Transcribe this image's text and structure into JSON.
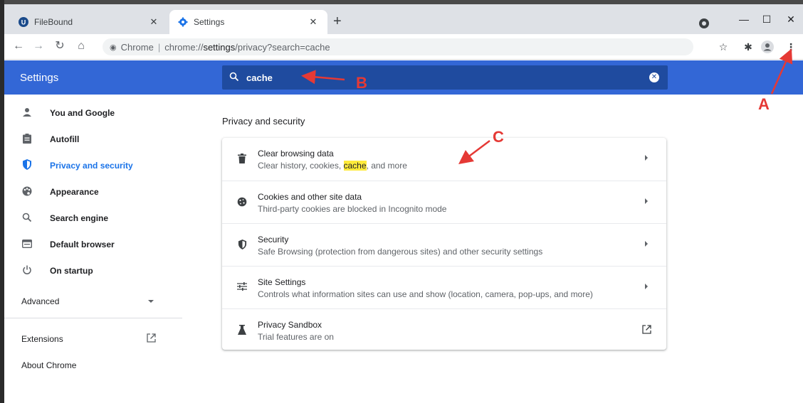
{
  "tabs": [
    {
      "title": "FileBound",
      "icon": "filebound-icon",
      "active": false
    },
    {
      "title": "Settings",
      "icon": "gear-icon",
      "active": true
    }
  ],
  "toolbar": {
    "scheme_label": "Chrome",
    "url_host": "chrome://",
    "url_path_bold": "settings",
    "url_rest": "/privacy?search=cache"
  },
  "header": {
    "title": "Settings",
    "search_value": "cache"
  },
  "sidebar": {
    "items": [
      {
        "label": "You and Google",
        "icon": "person-icon"
      },
      {
        "label": "Autofill",
        "icon": "clipboard-icon"
      },
      {
        "label": "Privacy and security",
        "icon": "shield-icon"
      },
      {
        "label": "Appearance",
        "icon": "palette-icon"
      },
      {
        "label": "Search engine",
        "icon": "search-icon"
      },
      {
        "label": "Default browser",
        "icon": "browser-icon"
      },
      {
        "label": "On startup",
        "icon": "power-icon"
      }
    ],
    "advanced": "Advanced",
    "extensions": "Extensions",
    "about": "About Chrome"
  },
  "main": {
    "section_title": "Privacy and security",
    "rows": [
      {
        "title": "Clear browsing data",
        "sub_before": "Clear history, cookies, ",
        "sub_highlight": "cache",
        "sub_after": ", and more",
        "icon": "trash-icon"
      },
      {
        "title": "Cookies and other site data",
        "subtitle": "Third-party cookies are blocked in Incognito mode",
        "icon": "cookie-icon"
      },
      {
        "title": "Security",
        "subtitle": "Safe Browsing (protection from dangerous sites) and other security settings",
        "icon": "shield-icon"
      },
      {
        "title": "Site Settings",
        "subtitle": "Controls what information sites can use and show (location, camera, pop-ups, and more)",
        "icon": "tune-icon"
      },
      {
        "title": "Privacy Sandbox",
        "subtitle": "Trial features are on",
        "icon": "flask-icon"
      }
    ]
  },
  "annotations": {
    "a": "A",
    "b": "B",
    "c": "C"
  },
  "colors": {
    "accent": "#3367d6",
    "search_bg": "#1f4b9f",
    "annotation": "#e53935",
    "highlight": "#ffeb3b"
  }
}
